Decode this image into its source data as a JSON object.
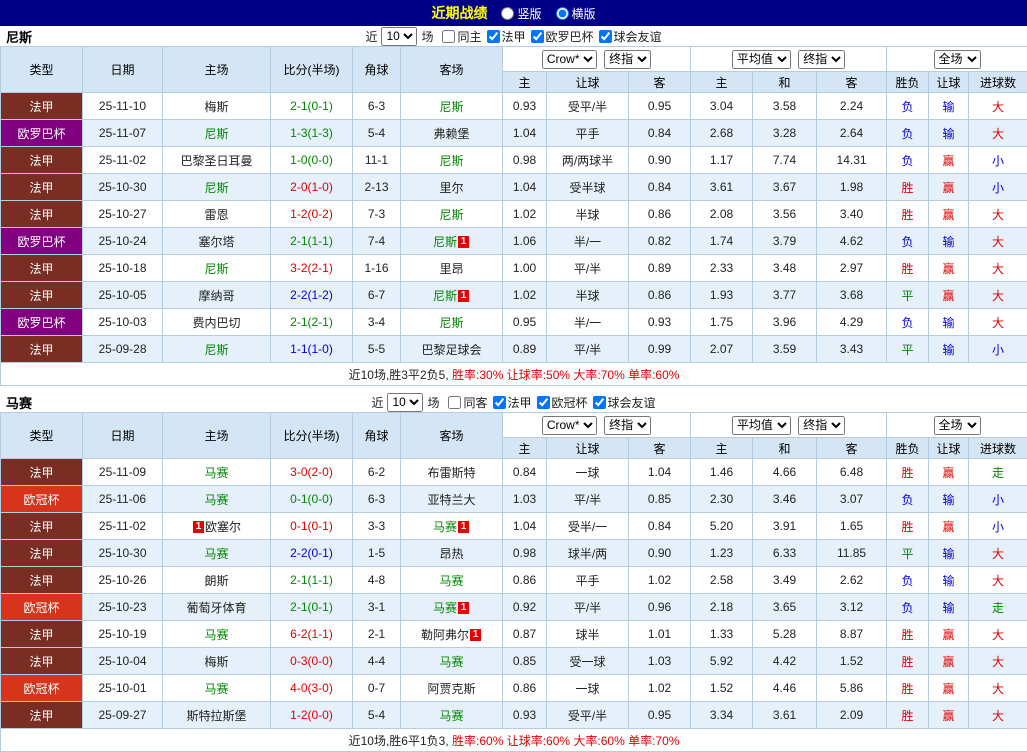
{
  "topbar": {
    "title": "近期战绩",
    "layout_options": [
      {
        "label": "竖版",
        "checked": false
      },
      {
        "label": "横版",
        "checked": true
      }
    ]
  },
  "table_header": {
    "static_cols": [
      "类型",
      "日期",
      "主场",
      "比分(半场)",
      "角球",
      "客场"
    ],
    "odds_company_select": "Crow*",
    "odds_final_select": "终指",
    "avg_select": "平均值",
    "avg_final_select": "终指",
    "scope_select": "全场",
    "sub_cols": [
      "主",
      "让球",
      "客",
      "主",
      "和",
      "客",
      "胜负",
      "让球",
      "进球数"
    ]
  },
  "league_colors": {
    "法甲": "#7A2E23",
    "欧罗巴杯": "#800080",
    "欧冠杯": "#D6341B"
  },
  "sections": [
    {
      "team": "尼斯",
      "filter": {
        "near_label": "近",
        "count": "10",
        "games_label": "场",
        "checkboxes": [
          {
            "label": "同主",
            "checked": false
          },
          {
            "label": "法甲",
            "checked": true
          },
          {
            "label": "欧罗巴杯",
            "checked": true
          },
          {
            "label": "球会友谊",
            "checked": true
          }
        ]
      },
      "rows": [
        {
          "league": "法甲",
          "date": "25-11-10",
          "home": {
            "name": "梅斯"
          },
          "score": "2-1(0-1)",
          "corner": "6-3",
          "away": {
            "name": "尼斯",
            "focal": true
          },
          "odds": [
            "0.93",
            "受平/半",
            "0.95"
          ],
          "avg": [
            "3.04",
            "3.58",
            "2.24"
          ],
          "result": "负",
          "handicap_result": "输",
          "goals": "大"
        },
        {
          "league": "欧罗巴杯",
          "date": "25-11-07",
          "home": {
            "name": "尼斯",
            "focal": true
          },
          "score": "1-3(1-3)",
          "corner": "5-4",
          "away": {
            "name": "弗赖堡"
          },
          "odds": [
            "1.04",
            "平手",
            "0.84"
          ],
          "avg": [
            "2.68",
            "3.28",
            "2.64"
          ],
          "result": "负",
          "handicap_result": "输",
          "goals": "大"
        },
        {
          "league": "法甲",
          "date": "25-11-02",
          "home": {
            "name": "巴黎圣日耳曼"
          },
          "score": "1-0(0-0)",
          "corner": "11-1",
          "away": {
            "name": "尼斯",
            "focal": true
          },
          "odds": [
            "0.98",
            "两/两球半",
            "0.90"
          ],
          "avg": [
            "1.17",
            "7.74",
            "14.31"
          ],
          "result": "负",
          "handicap_result": "赢",
          "goals": "小"
        },
        {
          "league": "法甲",
          "date": "25-10-30",
          "home": {
            "name": "尼斯",
            "focal": true
          },
          "score": "2-0(1-0)",
          "corner": "2-13",
          "away": {
            "name": "里尔"
          },
          "odds": [
            "1.04",
            "受半球",
            "0.84"
          ],
          "avg": [
            "3.61",
            "3.67",
            "1.98"
          ],
          "result": "胜",
          "handicap_result": "赢",
          "goals": "小"
        },
        {
          "league": "法甲",
          "date": "25-10-27",
          "home": {
            "name": "雷恩"
          },
          "score": "1-2(0-2)",
          "corner": "7-3",
          "away": {
            "name": "尼斯",
            "focal": true
          },
          "odds": [
            "1.02",
            "半球",
            "0.86"
          ],
          "avg": [
            "2.08",
            "3.56",
            "3.40"
          ],
          "result": "胜",
          "handicap_result": "赢",
          "goals": "大"
        },
        {
          "league": "欧罗巴杯",
          "date": "25-10-24",
          "home": {
            "name": "塞尔塔"
          },
          "score": "2-1(1-1)",
          "corner": "7-4",
          "away": {
            "name": "尼斯",
            "focal": true,
            "red": "after"
          },
          "odds": [
            "1.06",
            "半/一",
            "0.82"
          ],
          "avg": [
            "1.74",
            "3.79",
            "4.62"
          ],
          "result": "负",
          "handicap_result": "输",
          "goals": "大"
        },
        {
          "league": "法甲",
          "date": "25-10-18",
          "home": {
            "name": "尼斯",
            "focal": true
          },
          "score": "3-2(2-1)",
          "corner": "1-16",
          "away": {
            "name": "里昂"
          },
          "odds": [
            "1.00",
            "平/半",
            "0.89"
          ],
          "avg": [
            "2.33",
            "3.48",
            "2.97"
          ],
          "result": "胜",
          "handicap_result": "赢",
          "goals": "大"
        },
        {
          "league": "法甲",
          "date": "25-10-05",
          "home": {
            "name": "摩纳哥"
          },
          "score": "2-2(1-2)",
          "corner": "6-7",
          "away": {
            "name": "尼斯",
            "focal": true,
            "red": "after"
          },
          "odds": [
            "1.02",
            "半球",
            "0.86"
          ],
          "avg": [
            "1.93",
            "3.77",
            "3.68"
          ],
          "result": "平",
          "handicap_result": "赢",
          "goals": "大"
        },
        {
          "league": "欧罗巴杯",
          "date": "25-10-03",
          "home": {
            "name": "费内巴切"
          },
          "score": "2-1(2-1)",
          "corner": "3-4",
          "away": {
            "name": "尼斯",
            "focal": true
          },
          "odds": [
            "0.95",
            "半/一",
            "0.93"
          ],
          "avg": [
            "1.75",
            "3.96",
            "4.29"
          ],
          "result": "负",
          "handicap_result": "输",
          "goals": "大"
        },
        {
          "league": "法甲",
          "date": "25-09-28",
          "home": {
            "name": "尼斯",
            "focal": true
          },
          "score": "1-1(1-0)",
          "corner": "5-5",
          "away": {
            "name": "巴黎足球会"
          },
          "odds": [
            "0.89",
            "平/半",
            "0.99"
          ],
          "avg": [
            "2.07",
            "3.59",
            "3.43"
          ],
          "result": "平",
          "handicap_result": "输",
          "goals": "小"
        }
      ],
      "summary": {
        "record": "近10场,胜3平2负5,",
        "rates": "胜率:30% 让球率:50% 大率:70% 单率:60%"
      }
    },
    {
      "team": "马赛",
      "filter": {
        "near_label": "近",
        "count": "10",
        "games_label": "场",
        "checkboxes": [
          {
            "label": "同客",
            "checked": false
          },
          {
            "label": "法甲",
            "checked": true
          },
          {
            "label": "欧冠杯",
            "checked": true
          },
          {
            "label": "球会友谊",
            "checked": true
          }
        ]
      },
      "rows": [
        {
          "league": "法甲",
          "date": "25-11-09",
          "home": {
            "name": "马赛",
            "focal": true
          },
          "score": "3-0(2-0)",
          "corner": "6-2",
          "away": {
            "name": "布雷斯特"
          },
          "odds": [
            "0.84",
            "一球",
            "1.04"
          ],
          "avg": [
            "1.46",
            "4.66",
            "6.48"
          ],
          "result": "胜",
          "handicap_result": "赢",
          "goals": "走"
        },
        {
          "league": "欧冠杯",
          "date": "25-11-06",
          "home": {
            "name": "马赛",
            "focal": true
          },
          "score": "0-1(0-0)",
          "corner": "6-3",
          "away": {
            "name": "亚特兰大"
          },
          "odds": [
            "1.03",
            "平/半",
            "0.85"
          ],
          "avg": [
            "2.30",
            "3.46",
            "3.07"
          ],
          "result": "负",
          "handicap_result": "输",
          "goals": "小"
        },
        {
          "league": "法甲",
          "date": "25-11-02",
          "home": {
            "name": "欧塞尔",
            "red": "before"
          },
          "score": "0-1(0-1)",
          "corner": "3-3",
          "away": {
            "name": "马赛",
            "focal": true,
            "red": "after"
          },
          "odds": [
            "1.04",
            "受半/一",
            "0.84"
          ],
          "avg": [
            "5.20",
            "3.91",
            "1.65"
          ],
          "result": "胜",
          "handicap_result": "赢",
          "goals": "小"
        },
        {
          "league": "法甲",
          "date": "25-10-30",
          "home": {
            "name": "马赛",
            "focal": true
          },
          "score": "2-2(0-1)",
          "corner": "1-5",
          "away": {
            "name": "昂热"
          },
          "odds": [
            "0.98",
            "球半/两",
            "0.90"
          ],
          "avg": [
            "1.23",
            "6.33",
            "11.85"
          ],
          "result": "平",
          "handicap_result": "输",
          "goals": "大"
        },
        {
          "league": "法甲",
          "date": "25-10-26",
          "home": {
            "name": "朗斯"
          },
          "score": "2-1(1-1)",
          "corner": "4-8",
          "away": {
            "name": "马赛",
            "focal": true
          },
          "odds": [
            "0.86",
            "平手",
            "1.02"
          ],
          "avg": [
            "2.58",
            "3.49",
            "2.62"
          ],
          "result": "负",
          "handicap_result": "输",
          "goals": "大"
        },
        {
          "league": "欧冠杯",
          "date": "25-10-23",
          "home": {
            "name": "葡萄牙体育"
          },
          "score": "2-1(0-1)",
          "corner": "3-1",
          "away": {
            "name": "马赛",
            "focal": true,
            "red": "after"
          },
          "odds": [
            "0.92",
            "平/半",
            "0.96"
          ],
          "avg": [
            "2.18",
            "3.65",
            "3.12"
          ],
          "result": "负",
          "handicap_result": "输",
          "goals": "走"
        },
        {
          "league": "法甲",
          "date": "25-10-19",
          "home": {
            "name": "马赛",
            "focal": true
          },
          "score": "6-2(1-1)",
          "corner": "2-1",
          "away": {
            "name": "勒阿弗尔",
            "red": "after"
          },
          "odds": [
            "0.87",
            "球半",
            "1.01"
          ],
          "avg": [
            "1.33",
            "5.28",
            "8.87"
          ],
          "result": "胜",
          "handicap_result": "赢",
          "goals": "大"
        },
        {
          "league": "法甲",
          "date": "25-10-04",
          "home": {
            "name": "梅斯"
          },
          "score": "0-3(0-0)",
          "corner": "4-4",
          "away": {
            "name": "马赛",
            "focal": true
          },
          "odds": [
            "0.85",
            "受一球",
            "1.03"
          ],
          "avg": [
            "5.92",
            "4.42",
            "1.52"
          ],
          "result": "胜",
          "handicap_result": "赢",
          "goals": "大"
        },
        {
          "league": "欧冠杯",
          "date": "25-10-01",
          "home": {
            "name": "马赛",
            "focal": true
          },
          "score": "4-0(3-0)",
          "corner": "0-7",
          "away": {
            "name": "阿贾克斯"
          },
          "odds": [
            "0.86",
            "一球",
            "1.02"
          ],
          "avg": [
            "1.52",
            "4.46",
            "5.86"
          ],
          "result": "胜",
          "handicap_result": "赢",
          "goals": "大"
        },
        {
          "league": "法甲",
          "date": "25-09-27",
          "home": {
            "name": "斯特拉斯堡"
          },
          "score": "1-2(0-0)",
          "corner": "5-4",
          "away": {
            "name": "马赛",
            "focal": true
          },
          "odds": [
            "0.93",
            "受平/半",
            "0.95"
          ],
          "avg": [
            "3.34",
            "3.61",
            "2.09"
          ],
          "result": "胜",
          "handicap_result": "赢",
          "goals": "大"
        }
      ],
      "summary": {
        "record": "近10场,胜6平1负3,",
        "rates": "胜率:60% 让球率:60% 大率:60% 单率:70%"
      }
    }
  ]
}
